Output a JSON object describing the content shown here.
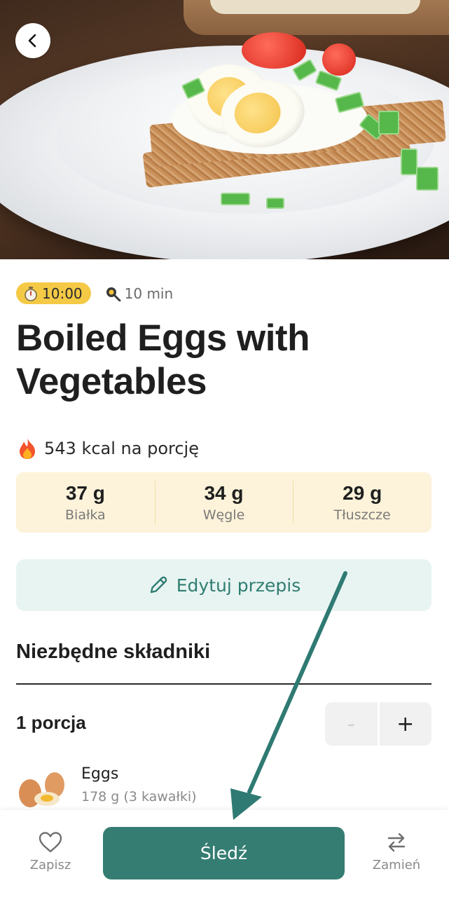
{
  "hero": {
    "alt": "Boiled eggs with cream cheese, tomatoes, cucumber and chives on crispbread"
  },
  "recipe": {
    "time_badge": "10:00",
    "duration": "10 min",
    "title": "Boiled Eggs with Vegetables",
    "kcal": "543 kcal na porcję"
  },
  "macros": [
    {
      "value": "37 g",
      "label": "Białka"
    },
    {
      "value": "34 g",
      "label": "Węgle"
    },
    {
      "value": "29 g",
      "label": "Tłuszcze"
    }
  ],
  "edit_button": {
    "label": "Edytuj przepis"
  },
  "ingredients_section": {
    "title": "Niezbędne składniki",
    "servings": "1 porcja",
    "stepper": {
      "minus": "-",
      "plus": "+"
    },
    "items": [
      {
        "name": "Eggs",
        "amount": "178 g (3 kawałki)"
      }
    ]
  },
  "bottom_bar": {
    "save_label": "Zapisz",
    "track_label": "Śledź",
    "swap_label": "Zamień"
  },
  "colors": {
    "accent": "#357d72",
    "badge": "#f4c945",
    "macros_bg": "#fdf3da",
    "edit_bg": "#e8f4f2"
  },
  "icons": [
    "back-arrow-icon",
    "stopwatch-icon",
    "frying-pan-icon",
    "fire-icon",
    "pencil-icon",
    "egg-image",
    "heart-icon",
    "swap-icon"
  ]
}
